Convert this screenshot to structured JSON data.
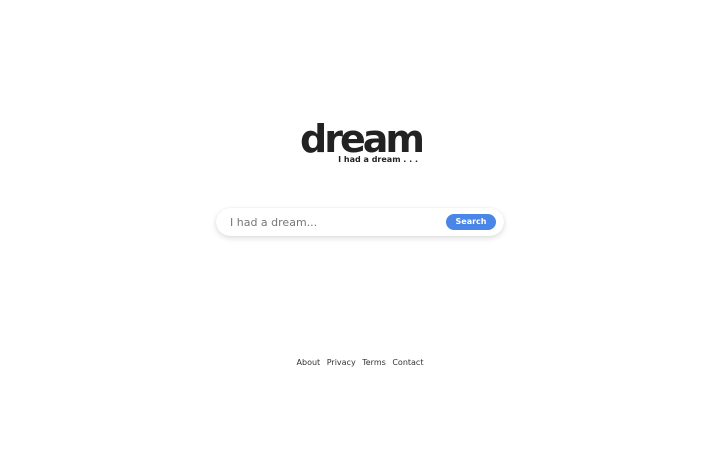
{
  "logo": {
    "wordmark": "dream",
    "tagline": "I had a dream . . .",
    "color": "#222222"
  },
  "search": {
    "placeholder": "I had a dream...",
    "value": "",
    "button_label": "Search",
    "button_color": "#4a86e8"
  },
  "footer": {
    "links": [
      "About",
      "Privacy",
      "Terms",
      "Contact"
    ]
  }
}
